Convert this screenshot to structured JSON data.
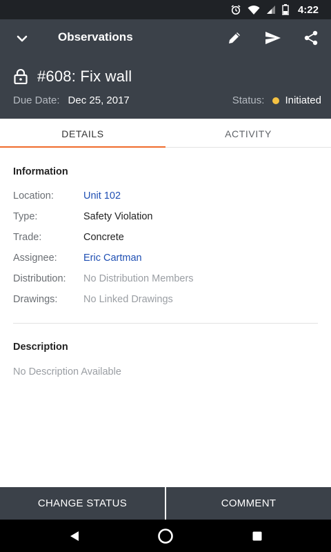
{
  "status_bar": {
    "time": "4:22"
  },
  "toolbar": {
    "title": "Observations"
  },
  "observation": {
    "title": "#608: Fix wall",
    "due_date_label": "Due Date:",
    "due_date": "Dec 25, 2017",
    "status_label": "Status:",
    "status": "Initiated",
    "status_color": "#f5c242"
  },
  "tabs": [
    {
      "label": "DETAILS",
      "active": true
    },
    {
      "label": "ACTIVITY",
      "active": false
    }
  ],
  "information": {
    "title": "Information",
    "rows": [
      {
        "key": "Location:",
        "value": "Unit 102"
      },
      {
        "key": "Type:",
        "value": "Safety Violation"
      },
      {
        "key": "Trade:",
        "value": "Concrete"
      },
      {
        "key": "Assignee:",
        "value": "Eric Cartman"
      },
      {
        "key": "Distribution:",
        "value": "No Distribution Members"
      },
      {
        "key": "Drawings:",
        "value": "No Linked Drawings"
      }
    ]
  },
  "description": {
    "title": "Description",
    "text": "No Description Available"
  },
  "actions": {
    "change_status": "CHANGE STATUS",
    "comment": "COMMENT"
  },
  "colors": {
    "header_bg": "#3b4149",
    "accent": "#f06a2a",
    "link": "#1f4fb3"
  }
}
